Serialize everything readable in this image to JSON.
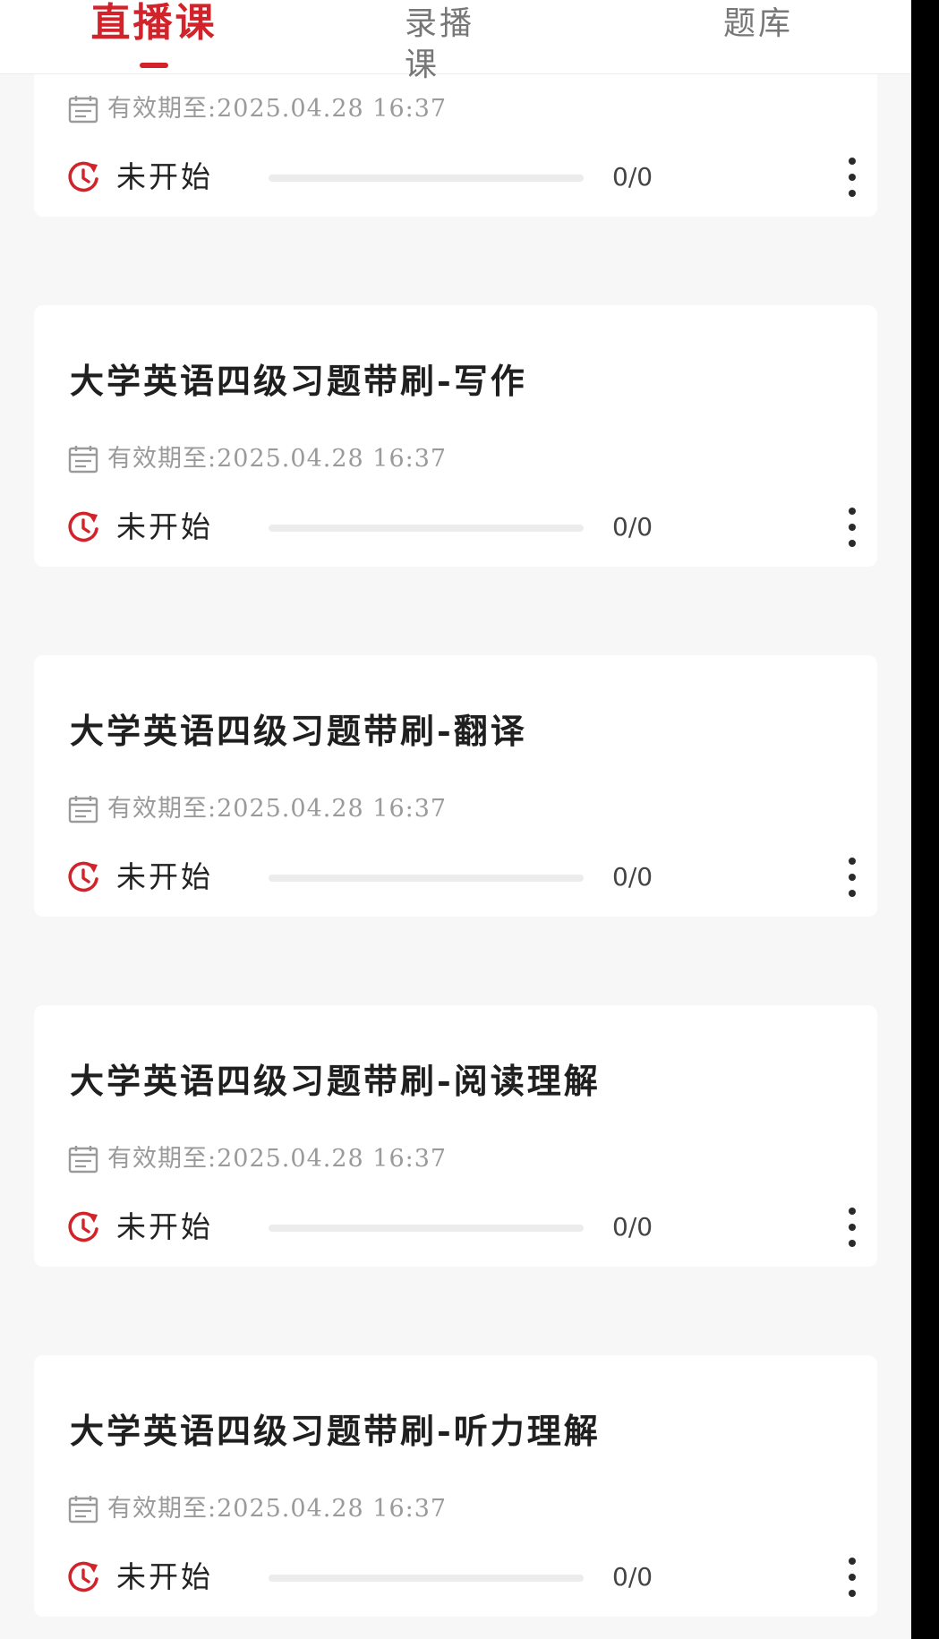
{
  "tabs": {
    "live": "直播课",
    "recorded": "录播课",
    "questions": "题库",
    "active": "live"
  },
  "colors": {
    "accent": "#d2222a",
    "title": "#1f1f1f",
    "muted": "#9a9a9a",
    "background": "#f7f7f7"
  },
  "courses": [
    {
      "title": "",
      "validity": "有效期至:2025.04.28 16:37",
      "status": "未开始",
      "progress": 0,
      "count": "0/0"
    },
    {
      "title": "大学英语四级习题带刷-写作",
      "validity": "有效期至:2025.04.28 16:37",
      "status": "未开始",
      "progress": 0,
      "count": "0/0"
    },
    {
      "title": "大学英语四级习题带刷-翻译",
      "validity": "有效期至:2025.04.28 16:37",
      "status": "未开始",
      "progress": 0,
      "count": "0/0"
    },
    {
      "title": "大学英语四级习题带刷-阅读理解",
      "validity": "有效期至:2025.04.28 16:37",
      "status": "未开始",
      "progress": 0,
      "count": "0/0"
    },
    {
      "title": "大学英语四级习题带刷-听力理解",
      "validity": "有效期至:2025.04.28 16:37",
      "status": "未开始",
      "progress": 0,
      "count": "0/0"
    }
  ],
  "icons": {
    "validity": "calendar-icon",
    "status": "restart-clock-icon",
    "more": "more-vertical-icon"
  }
}
